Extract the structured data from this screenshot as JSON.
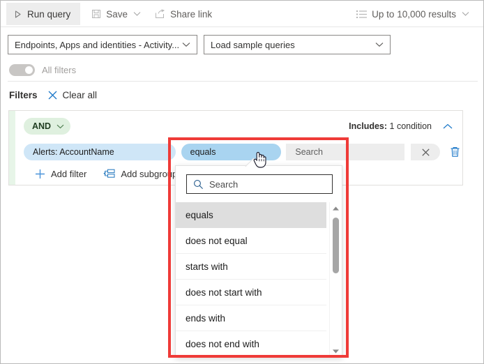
{
  "toolbar": {
    "run_query": "Run query",
    "run_query_icon": "play-triangle-icon",
    "save": "Save",
    "save_icon": "floppy-disk-icon",
    "save_caret_icon": "chevron-down-icon",
    "share_link": "Share link",
    "share_icon": "share-arrow-icon",
    "results_limit": "Up to 10,000 results",
    "results_icon": "list-icon",
    "results_caret_icon": "chevron-down-icon"
  },
  "scope": {
    "query_scope_value": "Endpoints, Apps and identities - Activity...",
    "query_scope_caret_icon": "chevron-down-icon",
    "sample_queries_value": "Load sample queries",
    "sample_queries_caret_icon": "chevron-down-icon"
  },
  "all_filters": {
    "label": "All filters",
    "toggle_state": "off"
  },
  "filters_header": {
    "title": "Filters",
    "clear_all": "Clear all",
    "clear_all_icon": "close-x-icon"
  },
  "group": {
    "operator": "AND",
    "operator_caret_icon": "chevron-down-icon",
    "includes_label": "Includes:",
    "includes_value": "1 condition",
    "collapse_icon": "chevron-up-icon",
    "condition": {
      "field": "Alerts: AccountName",
      "operator": "equals",
      "value_placeholder": "Search",
      "clear_icon": "close-x-icon",
      "delete_icon": "trash-icon"
    },
    "add_filter": "Add filter",
    "add_filter_icon": "plus-icon",
    "add_subgroup": "Add subgroup",
    "add_subgroup_icon": "subgroup-icon"
  },
  "dropdown": {
    "search_placeholder": "Search",
    "search_icon": "search-magnifier-icon",
    "scroll_up_icon": "caret-up-icon",
    "scroll_down_icon": "caret-down-icon",
    "selected": "equals",
    "options": [
      "equals",
      "does not equal",
      "starts with",
      "does not start with",
      "ends with",
      "does not end with"
    ]
  },
  "annotation": {
    "highlight_color": "#ef3b38"
  },
  "cursor": {
    "type": "pointing-hand"
  }
}
